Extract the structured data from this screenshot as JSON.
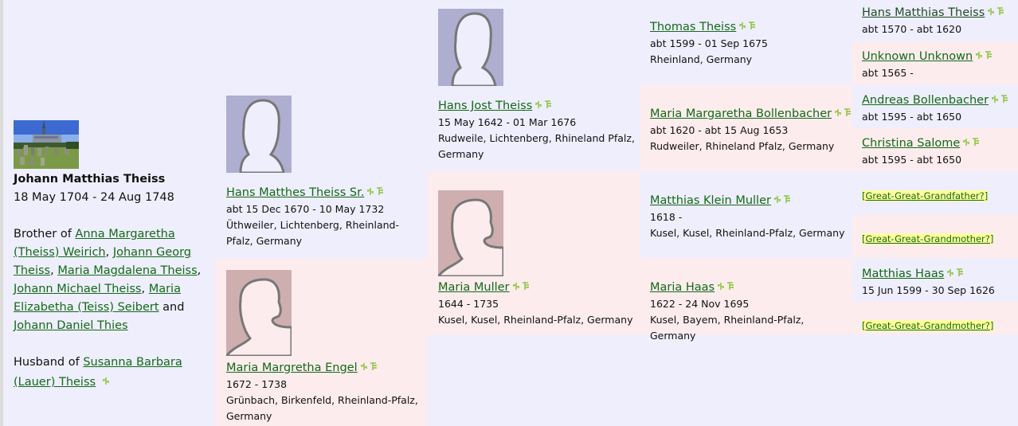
{
  "subject": {
    "photo_alt": "church-cemetery-photo",
    "name": "Johann Matthias Theiss",
    "dates": "18 May 1704 - 24 Aug 1748",
    "brother_of_prefix": "Brother of ",
    "siblings": [
      "Anna Margaretha (Theiss) Weirich",
      "Johann Georg Theiss",
      "Maria Magdalena Theiss",
      "Johann Michael Theiss",
      "Maria Elizabetha (Teiss) Seibert",
      "Johann Daniel Thies"
    ],
    "sep_comma": ", ",
    "sep_and": " and ",
    "husband_of_prefix": "Husband of ",
    "spouse": "Susanna Barbara (Lauer) Theiss"
  },
  "parents": {
    "father": {
      "name": "Hans Matthes Theiss Sr.",
      "dates": "abt 15 Dec 1670 - 10 May 1732",
      "place": "Üthweiler, Lichtenberg, Rheinland-Pfalz, Germany"
    },
    "mother": {
      "name": "Maria Margretha Engel",
      "dates": "1672 - 1738",
      "place": "Grünbach, Birkenfeld, Rheinland-Pfalz, Germany"
    }
  },
  "grandparents": {
    "paternal_grandfather": {
      "name": "Hans Jost Theiss",
      "dates": "15 May 1642 - 01 Mar 1676",
      "place": "Rudweile, Lichtenberg, Rhineland Pfalz, Germany"
    },
    "paternal_grandmother": {
      "name": "Maria Muller",
      "dates": "1644 - 1735",
      "place": "Kusel, Kusel, Rheinland-Pfalz, Germany"
    }
  },
  "great_grandparents": [
    {
      "name": "Thomas Theiss",
      "dates": "abt 1599 - 01 Sep 1675",
      "place": "Rheinland, Germany"
    },
    {
      "name": "Maria Margaretha Bollenbacher",
      "dates": "abt 1620 - abt 15 Aug 1653",
      "place": "Rudweiler, Rhineland Pfalz, Germany"
    },
    {
      "name": "Matthias Klein Muller",
      "dates": "1618 -",
      "place": "Kusel, Kusel, Rheinland-Pfalz, Germany"
    },
    {
      "name": "Maria Haas",
      "dates": "1622 - 24 Nov 1695",
      "place": "Kusel, Bayem, Rheinland-Pfalz, Germany"
    }
  ],
  "great_great_grandparents": [
    {
      "name": "Hans Matthias Theiss",
      "dates": "abt 1570 - abt 1620"
    },
    {
      "name": "Unknown Unknown",
      "dates": "abt 1565 -"
    },
    {
      "name": "Andreas Bollenbacher",
      "dates": "abt 1595 - abt 1650"
    },
    {
      "name": "Christina Salome",
      "dates": "abt 1595 - abt 1650"
    },
    {
      "placeholder": "[Great-Great-Grandfather?]"
    },
    {
      "placeholder": "[Great-Great-Grandmother?]"
    },
    {
      "name": "Matthias Haas",
      "dates": "15 Jun 1599 - 30 Sep 1626"
    },
    {
      "placeholder": "[Great-Great-Grandmother?]"
    }
  ],
  "icons": {
    "family": "family-group-icon",
    "tree": "family-tree-icon"
  },
  "colors": {
    "background": "#efeefd",
    "female_block": "#fdeced",
    "link": "#126a16",
    "icon": "#8cc63f",
    "missing_highlight": "#ffff9c"
  }
}
